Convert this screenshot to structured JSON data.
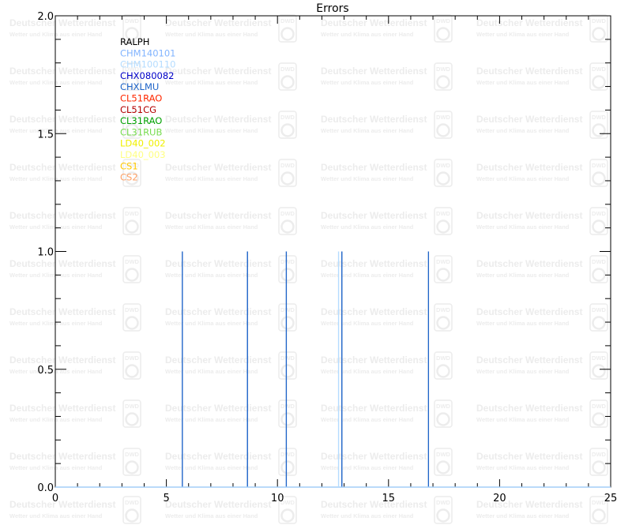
{
  "chart_data": {
    "type": "line",
    "title": "Errors",
    "xlabel": "",
    "ylabel": "",
    "xlim": [
      0,
      25
    ],
    "ylim": [
      0,
      2.0
    ],
    "x_ticks": [
      0,
      5,
      10,
      15,
      20,
      25
    ],
    "x_tick_labels": [
      "0",
      "5",
      "10",
      "15",
      "20",
      "25"
    ],
    "y_ticks": [
      0,
      0.5,
      1.0,
      1.5,
      2.0
    ],
    "y_tick_labels": [
      "0.0",
      "0.5",
      "1.0",
      "1.5",
      "2.0"
    ],
    "grid": false,
    "legend_position": "top-left",
    "legend": [
      {
        "label": "RALPH",
        "color": "#000000"
      },
      {
        "label": "CHM140101",
        "color": "#82b4ff"
      },
      {
        "label": "CHM100110",
        "color": "#b4dcff"
      },
      {
        "label": "CHX080082",
        "color": "#0000c8"
      },
      {
        "label": "CHXLMU",
        "color": "#1e64c8"
      },
      {
        "label": "CL51RAO",
        "color": "#ff2800"
      },
      {
        "label": "CL51CG",
        "color": "#b40000"
      },
      {
        "label": "CL31RAO",
        "color": "#00a000"
      },
      {
        "label": "CL31RUB",
        "color": "#78dc50"
      },
      {
        "label": "LD40_002",
        "color": "#f0f000"
      },
      {
        "label": "LD40_003",
        "color": "#ffff82"
      },
      {
        "label": "CS1",
        "color": "#ffc800"
      },
      {
        "label": "CS2",
        "color": "#ffa064"
      }
    ],
    "series": [
      {
        "color": "#1e64c8",
        "spikes": [
          5.72,
          8.65,
          10.4,
          12.9,
          16.8
        ],
        "height": 1.0
      },
      {
        "color": "#b4dcff",
        "spikes": [
          12.75
        ],
        "height": 1.0
      }
    ]
  },
  "watermark": {
    "line1": "Deutscher Wetterdienst",
    "line2": "Wetter und Klima aus einer Hand",
    "badge": "DWD"
  }
}
